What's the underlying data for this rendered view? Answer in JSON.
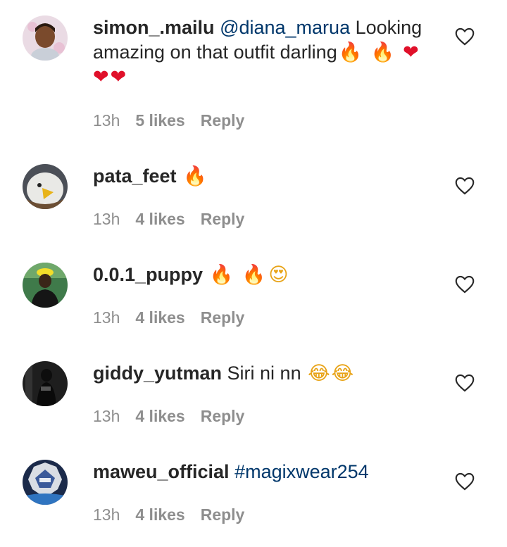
{
  "comments": [
    {
      "avatar": "avatar-cartoon-boy",
      "username": "simon_.mailu",
      "mention": "@diana_marua",
      "text": "Looking amazing on that outfit darling",
      "emoji1": "🔥 🔥",
      "emoji2": "❤",
      "emoji3": "❤❤",
      "time": "13h",
      "likes": "5 likes",
      "reply": "Reply"
    },
    {
      "avatar": "avatar-eagle",
      "username": "pata_feet",
      "emoji": "🔥",
      "time": "13h",
      "likes": "4 likes",
      "reply": "Reply"
    },
    {
      "avatar": "avatar-person-yellow-hat",
      "username": "0.0.1_puppy",
      "emoji": "🔥 🔥",
      "emoji_love": "😍",
      "time": "13h",
      "likes": "4 likes",
      "reply": "Reply"
    },
    {
      "avatar": "avatar-person-dark",
      "username": "giddy_yutman",
      "text": "Siri ni nn",
      "emoji": "😂😂",
      "time": "13h",
      "likes": "4 likes",
      "reply": "Reply"
    },
    {
      "avatar": "avatar-brand-logo",
      "username": "maweu_official",
      "hashtag": "#magixwear254",
      "time": "13h",
      "likes": "4 likes",
      "reply": "Reply"
    }
  ],
  "colors": {
    "username": "#262626",
    "link": "#00376b",
    "meta": "#8e8e8e"
  },
  "icons": {
    "like": "heart-outline-icon"
  }
}
